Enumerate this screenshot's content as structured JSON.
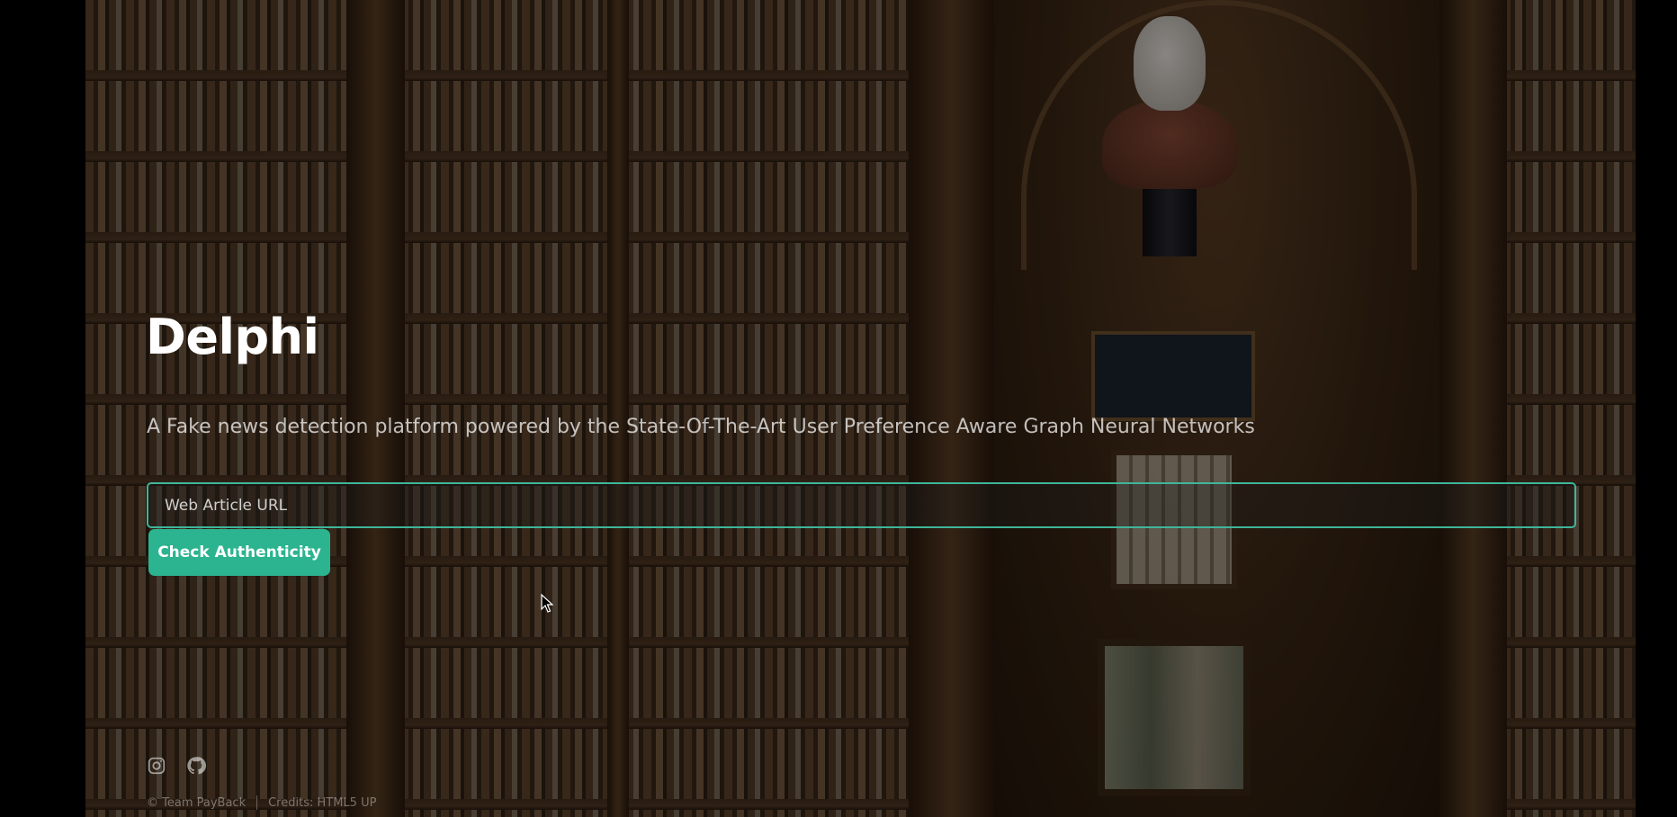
{
  "hero": {
    "title": "Delphi",
    "tagline": "A Fake news detection platform powered by the State-Of-The-Art User Preference Aware Graph Neural Networks"
  },
  "search": {
    "placeholder": "Web Article URL",
    "value": ""
  },
  "actions": {
    "check_label": "Check Authenticity"
  },
  "social": {
    "icons": [
      "instagram-icon",
      "github-icon"
    ]
  },
  "footer": {
    "copyright": "© Team PayBack",
    "credits": "Credits: HTML5 UP"
  },
  "colors": {
    "accent": "#2bb48f",
    "input_border": "#3fb59a",
    "title_text": "#ffffff"
  }
}
